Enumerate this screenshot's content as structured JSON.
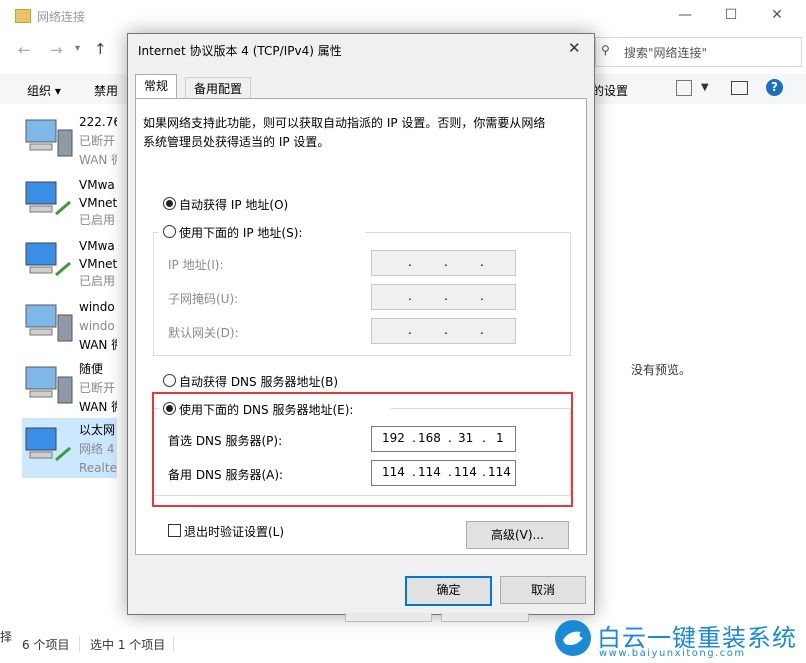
{
  "explorer": {
    "title": "网络连接",
    "search_placeholder": "搜索\"网络连接\"",
    "organize": "组织 ▾",
    "disable": "禁用",
    "change_settings": "的设置",
    "no_preview": "没有预览。",
    "items": [
      {
        "l1": "222.76",
        "l2": "已断开",
        "l3": "WAN 微"
      },
      {
        "l1": "VMwa",
        "l2": "VMnet",
        "l3": "已启用"
      },
      {
        "l1": "VMwa",
        "l2": "VMnet",
        "l3": "已启用"
      },
      {
        "l1": "windo",
        "l2": "windo",
        "l3": "WAN 微"
      },
      {
        "l1": "随便",
        "l2": "已断开",
        "l3": "WAN 微"
      },
      {
        "l1": "以太网",
        "l2": "网络 4",
        "l3": "Realte"
      }
    ],
    "status_count": "6 个项目",
    "status_selected": "选中 1 个项目",
    "left_edge_char": "择"
  },
  "dialog": {
    "title": "Internet 协议版本 4 (TCP/IPv4) 属性",
    "close": "✕",
    "tab_general": "常规",
    "tab_alternate": "备用配置",
    "description": "如果网络支持此功能，则可以获取自动指派的 IP 设置。否则，你需要从网络系统管理员处获得适当的 IP 设置。",
    "auto_ip": "自动获得 IP 地址(O)",
    "manual_ip": "使用下面的 IP 地址(S):",
    "ip_label": "IP 地址(I):",
    "mask_label": "子网掩码(U):",
    "gateway_label": "默认网关(D):",
    "auto_dns": "自动获得 DNS 服务器地址(B)",
    "manual_dns": "使用下面的 DNS 服务器地址(E):",
    "preferred_dns_label": "首选 DNS 服务器(P):",
    "alternate_dns_label": "备用 DNS 服务器(A):",
    "preferred_dns": {
      "o1": "192",
      "o2": "168",
      "o3": "31",
      "o4": "1"
    },
    "alternate_dns": {
      "o1": "114",
      "o2": "114",
      "o3": "114",
      "o4": "114"
    },
    "validate_on_exit": "退出时验证设置(L)",
    "advanced": "高级(V)...",
    "ok": "确定",
    "cancel": "取消",
    "selected_ip_mode": "auto",
    "selected_dns_mode": "manual",
    "validate_checked": false
  },
  "watermark": {
    "brand": "白云一键重装系统",
    "url": "www.baiyunxitong.com"
  },
  "colors": {
    "accent": "#0078d7",
    "highlight_border": "#e53935",
    "watermark_blue": "#1a8ad6"
  }
}
